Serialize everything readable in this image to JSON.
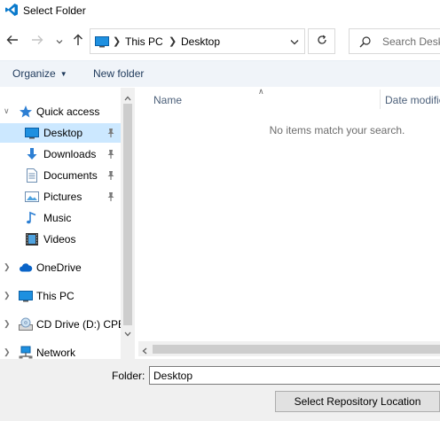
{
  "window": {
    "title": "Select Folder",
    "app_icon": "vscode-icon"
  },
  "nav": {
    "back_icon": "arrow-left-icon",
    "forward_icon": "arrow-right-icon",
    "recent_icon": "chevron-down-icon",
    "up_icon": "arrow-up-icon",
    "breadcrumbs": [
      "This PC",
      "Desktop"
    ],
    "refresh_icon": "refresh-icon",
    "search_placeholder": "Search Desktop"
  },
  "commands": {
    "organize_label": "Organize",
    "new_folder_label": "New folder"
  },
  "tree": {
    "items": [
      {
        "label": "Quick access",
        "icon": "star-icon",
        "expanded": true,
        "pinned": false
      },
      {
        "label": "Desktop",
        "icon": "desktop-icon",
        "pinned": true,
        "selected": true
      },
      {
        "label": "Downloads",
        "icon": "download-icon",
        "pinned": true
      },
      {
        "label": "Documents",
        "icon": "document-icon",
        "pinned": true
      },
      {
        "label": "Pictures",
        "icon": "picture-icon",
        "pinned": true
      },
      {
        "label": "Music",
        "icon": "music-icon",
        "pinned": false
      },
      {
        "label": "Videos",
        "icon": "video-icon",
        "pinned": false
      },
      {
        "label": "OneDrive",
        "icon": "cloud-icon",
        "expanded": false
      },
      {
        "label": "This PC",
        "icon": "computer-icon",
        "expanded": false
      },
      {
        "label": "CD Drive (D:) CPBA",
        "icon": "cd-drive-icon",
        "expanded": false
      },
      {
        "label": "Network",
        "icon": "network-icon",
        "expanded": false
      }
    ]
  },
  "filelist": {
    "columns": [
      "Name",
      "Date modified"
    ],
    "empty_message": "No items match your search."
  },
  "bottom": {
    "folder_label": "Folder:",
    "folder_value": "Desktop",
    "select_button": "Select Repository Location"
  },
  "colors": {
    "selection": "#cce8ff",
    "command_bar": "#f0f4f9",
    "command_text": "#1e395b",
    "footer": "#f0f0f0",
    "accent": "#0078d7"
  }
}
